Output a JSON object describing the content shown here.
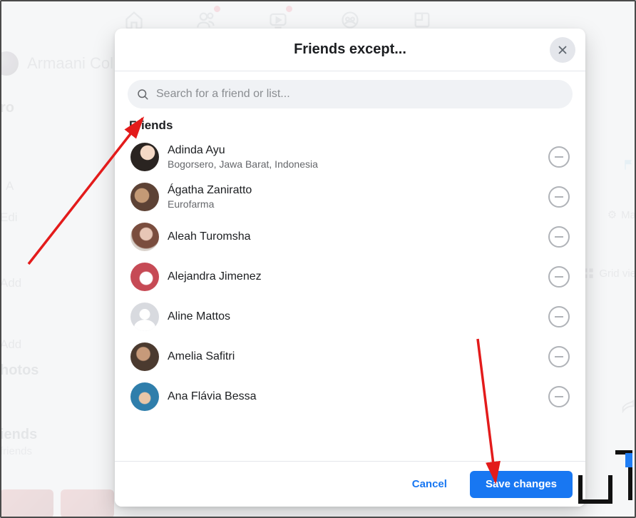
{
  "background": {
    "profile_name": "Armaani Col",
    "labels": {
      "intro": "ro",
      "a": "A",
      "edit": "Edi",
      "add1": "Add",
      "add2": "Add",
      "photos": "hotos",
      "friends": "iends",
      "friends_sub": "friends",
      "manage": "Ma",
      "grid": "Grid vie",
      "gear": "⚙"
    }
  },
  "modal": {
    "title": "Friends except...",
    "search_placeholder": "Search for a friend or list...",
    "section_label": "Friends",
    "cancel_label": "Cancel",
    "save_label": "Save changes"
  },
  "friends": [
    {
      "name": "Adinda Ayu",
      "sub": "Bogorsero, Jawa Barat, Indonesia"
    },
    {
      "name": "Ágatha Zaniratto",
      "sub": "Eurofarma"
    },
    {
      "name": "Aleah Turomsha",
      "sub": ""
    },
    {
      "name": "Alejandra Jimenez",
      "sub": ""
    },
    {
      "name": "Aline Mattos",
      "sub": ""
    },
    {
      "name": "Amelia Safitri",
      "sub": ""
    },
    {
      "name": "Ana Flávia Bessa",
      "sub": ""
    }
  ],
  "watermark": {
    "text": "GR"
  }
}
